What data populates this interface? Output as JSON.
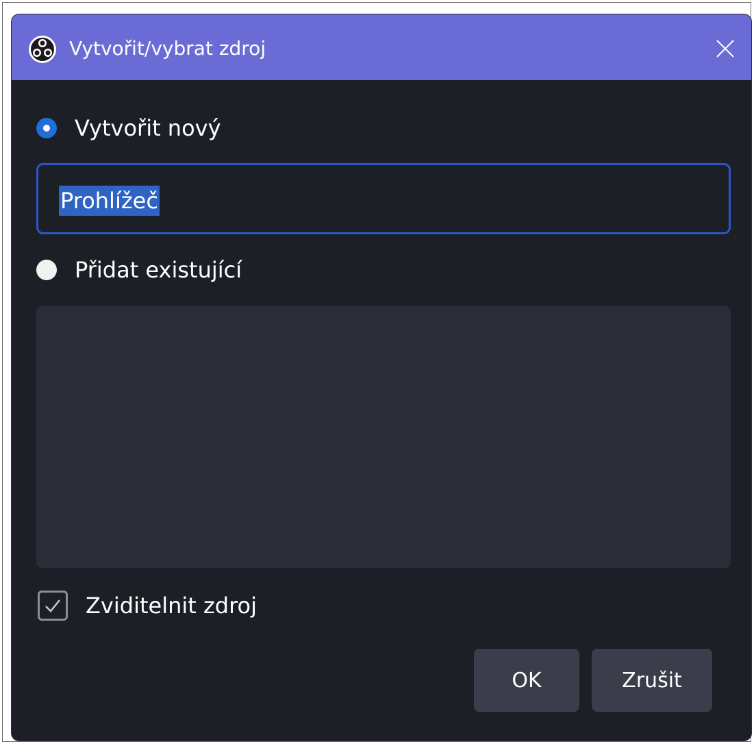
{
  "dialog": {
    "title": "Vytvořit/vybrat zdroj",
    "app_icon": "obs-logo-icon",
    "close_icon": "close-icon"
  },
  "create_new": {
    "label": "Vytvořit nový",
    "selected": true,
    "name_value": "Prohlížeč"
  },
  "add_existing": {
    "label": "Přidat existující",
    "selected": false,
    "items": []
  },
  "visibility": {
    "label": "Zviditelnit zdroj",
    "checked": true
  },
  "buttons": {
    "ok_label": "OK",
    "cancel_label": "Zrušit"
  },
  "colors": {
    "titlebar": "#6b6bd6",
    "background": "#1d1f26",
    "accent": "#1f6fd6",
    "selection": "#2f64c4",
    "button": "#3b3e4a"
  }
}
